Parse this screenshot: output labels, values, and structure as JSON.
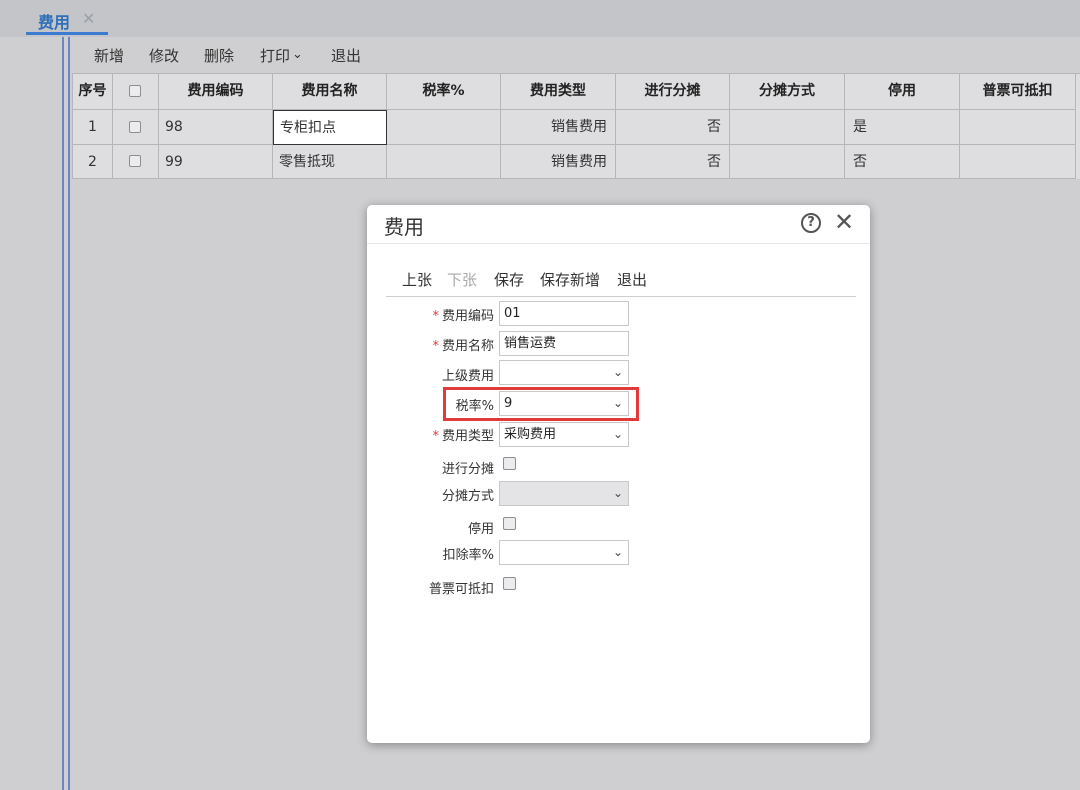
{
  "tab": {
    "label": "费用",
    "close": "✕"
  },
  "toolbar": {
    "add": "新增",
    "edit": "修改",
    "delete": "删除",
    "print": "打印",
    "print_caret": "⌄",
    "exit": "退出"
  },
  "table": {
    "headers": [
      "序号",
      "",
      "费用编码",
      "费用名称",
      "税率%",
      "费用类型",
      "进行分摊",
      "分摊方式",
      "停用",
      "普票可抵扣"
    ],
    "rows": [
      {
        "index": "1",
        "code": "98",
        "name": "专柜扣点",
        "tax": "",
        "type": "销售费用",
        "allocate": "否",
        "method": "",
        "disabled": "是",
        "deductible": ""
      },
      {
        "index": "2",
        "code": "99",
        "name": "零售抵现",
        "tax": "",
        "type": "销售费用",
        "allocate": "否",
        "method": "",
        "disabled": "否",
        "deductible": ""
      }
    ]
  },
  "dialog": {
    "title": "费用",
    "help": "?",
    "close": "✕",
    "toolbar": {
      "prev": "上张",
      "next": "下张",
      "save": "保存",
      "save_new": "保存新增",
      "exit": "退出"
    },
    "required_mark": "*",
    "fields": {
      "code_label": "费用编码",
      "code_value": "01",
      "name_label": "费用名称",
      "name_value": "销售运费",
      "parent_label": "上级费用",
      "parent_value": "",
      "tax_label": "税率%",
      "tax_value": "9",
      "type_label": "费用类型",
      "type_value": "采购费用",
      "allocate_label": "进行分摊",
      "method_label": "分摊方式",
      "method_value": "",
      "disabled_label": "停用",
      "deduct_rate_label": "扣除率%",
      "deduct_rate_value": "",
      "deductible_label": "普票可抵扣"
    },
    "caret": "⌄"
  },
  "colors": {
    "accent": "#3b7bd0",
    "highlight": "#e03a3a",
    "required": "#e23a3a"
  }
}
